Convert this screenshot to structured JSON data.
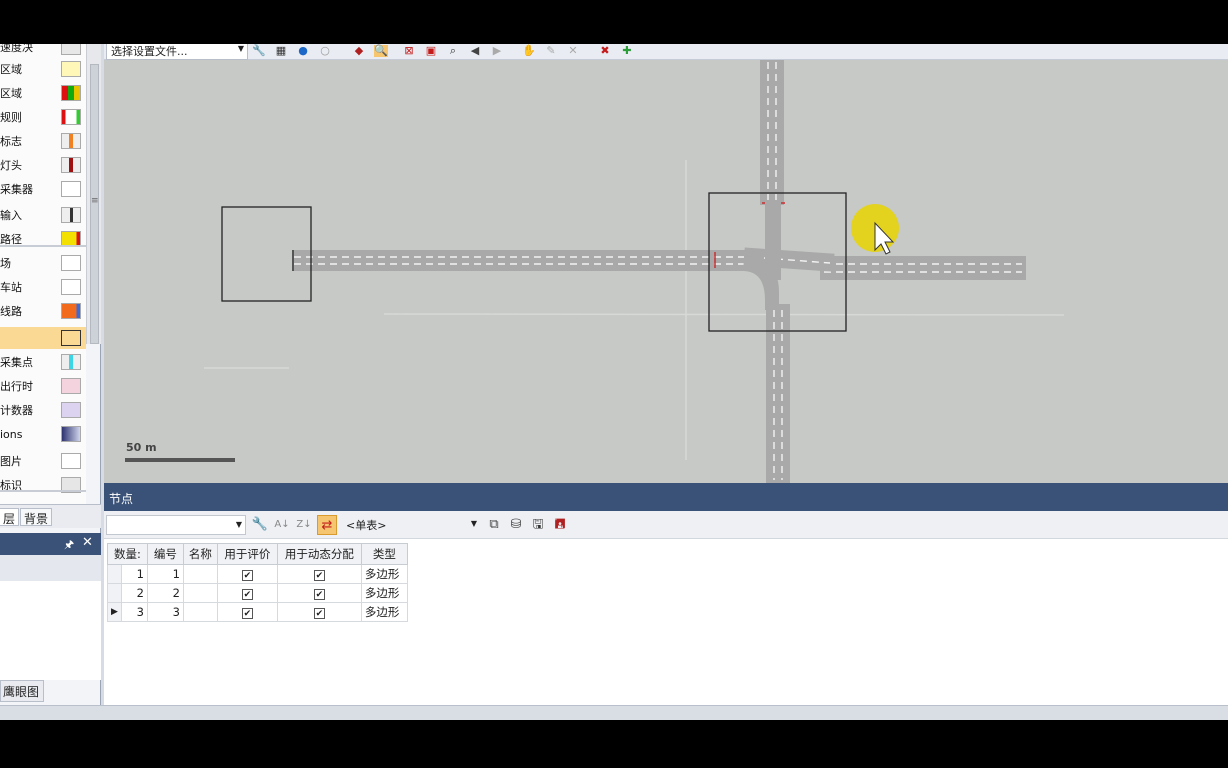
{
  "left_panel": {
    "layers": [
      {
        "label": "速度决",
        "swatch": "#e7e7e7"
      },
      {
        "label": "区域",
        "swatch": "#fff7b8"
      },
      {
        "label": "区域",
        "swatch": "linear-gradient(90deg,#d11 0 33%,#1a1 33% 66%,#e8c300 66%)"
      },
      {
        "label": "规则",
        "swatch": "linear-gradient(90deg,#d11 0 20%,#fff 20% 80%,#3c3 80%)"
      },
      {
        "label": "标志",
        "swatch": "linear-gradient(90deg,#eee 0 40%,#f08020 40% 60%,#eee 60%)"
      },
      {
        "label": "灯头",
        "swatch": "linear-gradient(90deg,#eee 0 40%,#a01010 40% 60%,#eee 60%)"
      },
      {
        "label": "采集器",
        "swatch": "#ffffff"
      },
      {
        "label": "输入",
        "swatch": "linear-gradient(90deg,#eee 0 45%,#333 45% 60%,#eee 60%)"
      },
      {
        "label": "路径",
        "swatch": "linear-gradient(90deg,#f3e000 0 80%,#d11 80%)"
      },
      {
        "label": "场",
        "swatch": "#ffffff"
      },
      {
        "label": "车站",
        "swatch": "#ffffff"
      },
      {
        "label": "线路",
        "swatch": "linear-gradient(90deg,#f26a1b 0 80%,#3a6bd8 80%)"
      },
      {
        "label": "",
        "swatch": "#f9d994"
      },
      {
        "label": "采集点",
        "swatch": "linear-gradient(90deg,#eee 0 40%,#3bd6e6 40% 60%,#eee 60%)"
      },
      {
        "label": "出行时",
        "swatch": "#f4d3df"
      },
      {
        "label": "计数器",
        "swatch": "#dcd3f0"
      },
      {
        "label": "ions",
        "swatch": "linear-gradient(90deg,#2d3470,#d0d4ec)"
      },
      {
        "label": "图片",
        "swatch": "#ffffff"
      },
      {
        "label": "标识",
        "swatch": "#e6e6e6"
      }
    ],
    "tabs": [
      "层",
      "背景"
    ],
    "bottom_tab": "鹰眼图"
  },
  "top_toolbar": {
    "preset_value": "选择设置文件..."
  },
  "canvas": {
    "scale_label": "50 m"
  },
  "grid": {
    "title": "节点",
    "list_value": "<单表>",
    "columns": [
      "数量:",
      "编号",
      "名称",
      "用于评价",
      "用于动态分配",
      "类型"
    ],
    "rows": [
      {
        "count": "1",
        "id": "1",
        "name": "",
        "eval": true,
        "dyn": true,
        "type": "多边形",
        "current": false
      },
      {
        "count": "2",
        "id": "2",
        "name": "",
        "eval": true,
        "dyn": true,
        "type": "多边形",
        "current": false
      },
      {
        "count": "3",
        "id": "3",
        "name": "",
        "eval": true,
        "dyn": true,
        "type": "多边形",
        "current": true
      }
    ]
  },
  "colors": {
    "panel_header": "#3a5278",
    "canvas_bg": "#c6c9c6",
    "road": "#a8a9a8",
    "highlight": "#f9d994",
    "cursor_halo": "#e7d400"
  }
}
